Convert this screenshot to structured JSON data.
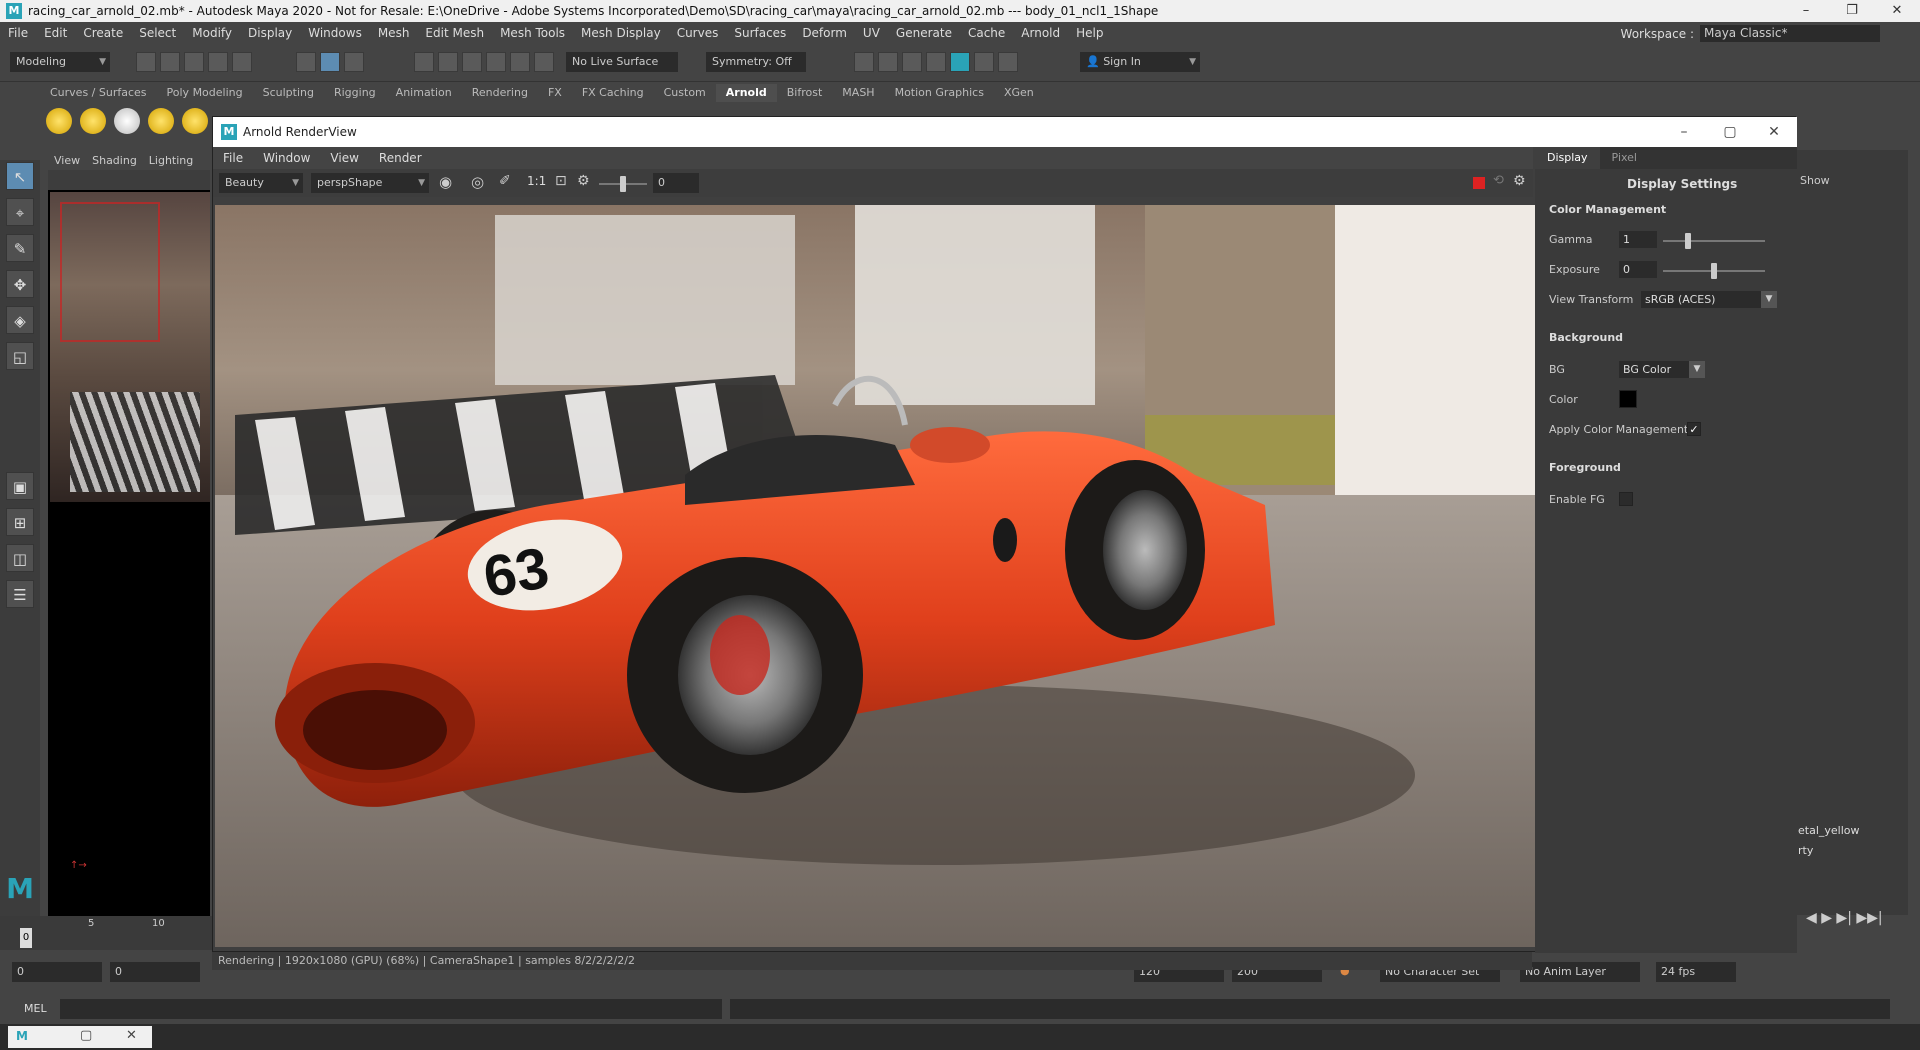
{
  "titlebar": {
    "text": "racing_car_arnold_02.mb* - Autodesk Maya 2020 - Not for Resale: E:\\OneDrive - Adobe Systems Incorporated\\Demo\\SD\\racing_car\\maya\\racing_car_arnold_02.mb  ---  body_01_ncl1_1Shape",
    "minimize": "–",
    "restore": "❐",
    "close": "✕"
  },
  "menu": [
    "File",
    "Edit",
    "Create",
    "Select",
    "Modify",
    "Display",
    "Windows",
    "Mesh",
    "Edit Mesh",
    "Mesh Tools",
    "Mesh Display",
    "Curves",
    "Surfaces",
    "Deform",
    "UV",
    "Generate",
    "Cache",
    "Arnold",
    "Help"
  ],
  "workspace": {
    "label": "Workspace :",
    "value": "Maya Classic*"
  },
  "statusline": {
    "mode": "Modeling",
    "live_surface": "No Live Surface",
    "symmetry": "Symmetry: Off",
    "sign_in": "Sign In"
  },
  "shelf_tabs": [
    "Curves / Surfaces",
    "Poly Modeling",
    "Sculpting",
    "Rigging",
    "Animation",
    "Rendering",
    "FX",
    "FX Caching",
    "Custom",
    "Arnold",
    "Bifrost",
    "MASH",
    "Motion Graphics",
    "XGen"
  ],
  "shelf_active": "Arnold",
  "viewport_menu": [
    "View",
    "Shading",
    "Lighting"
  ],
  "timeline": {
    "ticks": [
      "5",
      "10"
    ],
    "current": "0"
  },
  "range": {
    "start": "0",
    "start2": "0",
    "val120": "120",
    "end1": "120",
    "end2": "200",
    "char_set": "No Character Set",
    "anim_layer": "No Anim Layer",
    "fps": "24 fps"
  },
  "mel": {
    "label": "MEL"
  },
  "renderview": {
    "title": "Arnold RenderView",
    "menu": [
      "File",
      "Window",
      "View",
      "Render"
    ],
    "aov": "Beauty",
    "camera": "perspShape",
    "ratio": "1:1",
    "exposure_value": "0",
    "status": "Rendering | 1920x1080 (GPU) (68%) | CameraShape1 | samples 8/2/2/2/2/2"
  },
  "display_panel": {
    "tabs": [
      "Display",
      "Pixel"
    ],
    "header": "Display Settings",
    "color_management": {
      "title": "Color Management",
      "gamma_label": "Gamma",
      "gamma_value": "1",
      "gamma_level": 0.22,
      "exposure_label": "Exposure",
      "exposure_value": "0",
      "exposure_level": 0.5,
      "view_transform_label": "View Transform",
      "view_transform_value": "sRGB (ACES)"
    },
    "background": {
      "title": "Background",
      "bg_label": "BG",
      "bg_value": "BG Color",
      "color_label": "Color",
      "color_swatch": "#000000",
      "apply_label": "Apply Color Management",
      "apply_checked": "✓"
    },
    "foreground": {
      "title": "Foreground",
      "enable_label": "Enable FG"
    }
  },
  "right_panel": {
    "show": "Show",
    "item1": "etal_yellow",
    "item2": "rty"
  },
  "car": {
    "number": "63",
    "body_color": "#e0401c"
  }
}
